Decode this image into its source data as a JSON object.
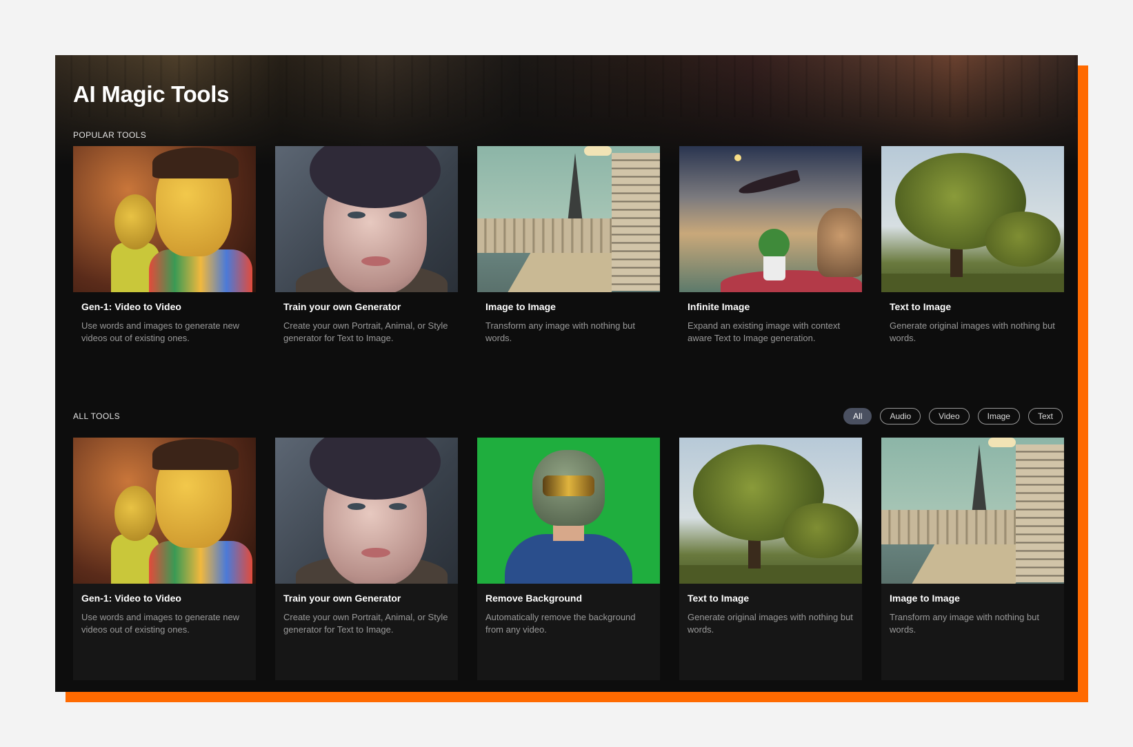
{
  "page": {
    "title": "AI Magic Tools"
  },
  "colors": {
    "background": "#f3f3f3",
    "panel": "#0d0d0d",
    "card": "#161616",
    "accent_shadow": "#ff6a00",
    "chip_active": "#4a5060"
  },
  "popular": {
    "label": "POPULAR TOOLS",
    "items": [
      {
        "name": "Gen-1: Video to Video",
        "desc": "Use words and images to generate new videos out of existing ones."
      },
      {
        "name": "Train your own Generator",
        "desc": "Create your own Portrait, Animal, or Style generator for Text to Image."
      },
      {
        "name": "Image to Image",
        "desc": "Transform any image with nothing but words."
      },
      {
        "name": "Infinite Image",
        "desc": "Expand an existing image with context aware Text to Image generation."
      },
      {
        "name": "Text to Image",
        "desc": "Generate original images with nothing but words."
      }
    ]
  },
  "all": {
    "label": "ALL TOOLS",
    "filters": [
      "All",
      "Audio",
      "Video",
      "Image",
      "Text"
    ],
    "active_filter": "All",
    "items": [
      {
        "name": "Gen-1: Video to Video",
        "desc": "Use words and images to generate new videos out of existing ones."
      },
      {
        "name": "Train your own Generator",
        "desc": "Create your own Portrait, Animal, or Style generator for Text to Image."
      },
      {
        "name": "Remove Background",
        "desc": "Automatically remove the background from any video."
      },
      {
        "name": "Text to Image",
        "desc": "Generate original images with nothing but words."
      },
      {
        "name": "Image to Image",
        "desc": "Transform any image with nothing but words."
      }
    ]
  }
}
